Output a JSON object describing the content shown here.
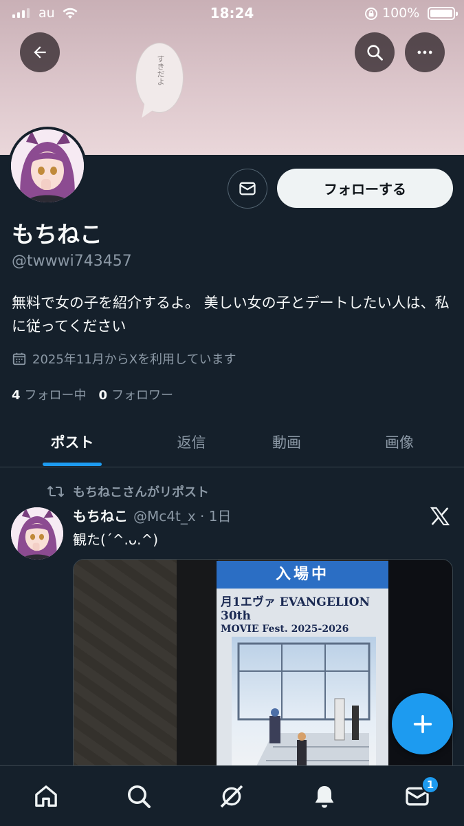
{
  "status_bar": {
    "carrier": "au",
    "time": "18:24",
    "battery": "100%"
  },
  "banner": {
    "bubble_text": "すきだよ"
  },
  "profile": {
    "display_name": "もちねこ",
    "handle": "@twwwi743457",
    "bio": "無料で女の子を紹介するよ。 美しい女の子とデートしたい人は、私に従ってください",
    "joined": "2025年11月からXを利用しています",
    "following_count": "4",
    "following_label": "フォロー中",
    "followers_count": "0",
    "followers_label": "フォロワー",
    "follow_button_label": "フォローする"
  },
  "tabs": [
    {
      "label": "ポスト",
      "active": true
    },
    {
      "label": "返信",
      "active": false
    },
    {
      "label": "動画",
      "active": false
    },
    {
      "label": "画像",
      "active": false
    }
  ],
  "post": {
    "repost_label": "もちねこさんがリポスト",
    "author_name": "もちねこ",
    "author_handle_time": "@Mc4t_x · 1日",
    "text": "観た(ˊ^.ᴗ.^)",
    "media": {
      "poster_header": "入場中",
      "poster_title_line1": "月1エヴァ EVANGELION 30th",
      "poster_title_line2": "MOVIE Fest. 2025-2026"
    }
  },
  "bottom_nav": {
    "items": [
      "home-icon",
      "search-icon",
      "grok-icon",
      "notifications-icon",
      "messages-icon"
    ],
    "messages_badge": "1"
  },
  "colors": {
    "background": "#15202b",
    "accent": "#1d9bf0",
    "muted_text": "#8b98a5",
    "border": "#38444d"
  }
}
